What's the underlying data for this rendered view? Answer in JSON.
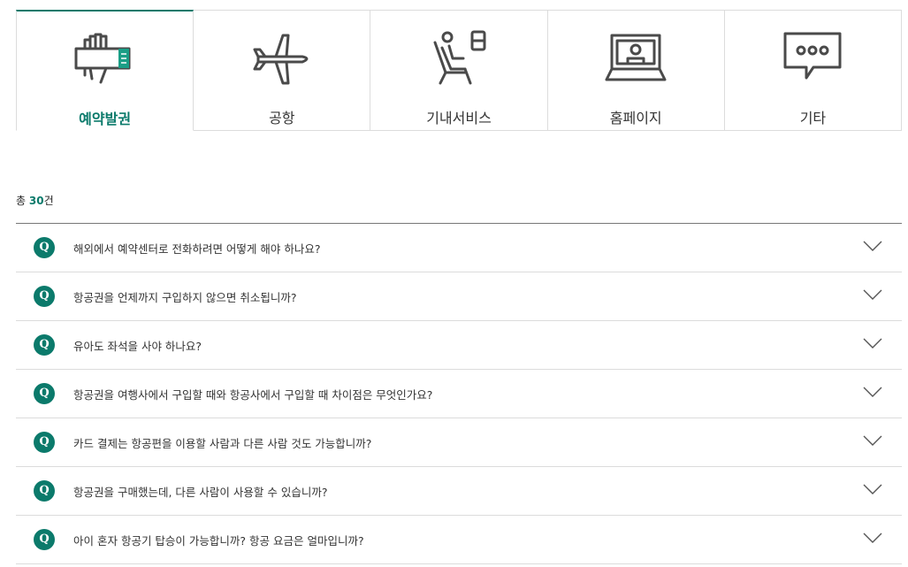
{
  "tabs": [
    {
      "label": "예약발권",
      "icon": "ticket-hand-icon",
      "active": true
    },
    {
      "label": "공항",
      "icon": "airplane-icon",
      "active": false
    },
    {
      "label": "기내서비스",
      "icon": "seat-icon",
      "active": false
    },
    {
      "label": "홈페이지",
      "icon": "laptop-icon",
      "active": false
    },
    {
      "label": "기타",
      "icon": "speech-bubble-icon",
      "active": false
    }
  ],
  "count": {
    "prefix": "총 ",
    "value": "30",
    "suffix": "건"
  },
  "faq": {
    "badge": "Q",
    "items": [
      {
        "question": "해외에서 예약센터로 전화하려면 어떻게 해야 하나요?"
      },
      {
        "question": "항공권을 언제까지 구입하지 않으면 취소됩니까?"
      },
      {
        "question": "유아도 좌석을 사야 하나요?"
      },
      {
        "question": "항공권을 여행사에서 구입할 때와 항공사에서 구입할 때 차이점은 무엇인가요?"
      },
      {
        "question": "카드 결제는 항공편을 이용할 사람과 다른 사람 것도 가능합니까?"
      },
      {
        "question": "항공권을 구매했는데, 다른 사람이 사용할 수 있습니까?"
      },
      {
        "question": "아이 혼자 항공기 탑승이 가능합니까? 항공 요금은 얼마입니까?"
      }
    ]
  },
  "colors": {
    "accent": "#0b7a6b",
    "border": "#dcdcdc",
    "icon": "#4a4a4a"
  }
}
